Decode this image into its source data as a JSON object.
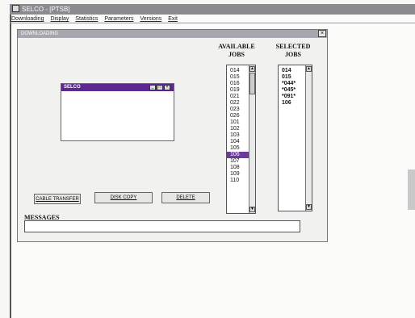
{
  "app": {
    "title": "SELCO - [PTSB]",
    "menu": [
      "Downloading",
      "Display",
      "Statistics",
      "Parameters",
      "Versions",
      "Exit"
    ]
  },
  "dialog": {
    "title": "DOWNLOADING",
    "close_glyph": "×"
  },
  "available_jobs": {
    "header_line1": "AVAILABLE",
    "header_line2": "JOBS",
    "items": [
      "014",
      "015",
      "016",
      "019",
      "021",
      "022",
      "023",
      "026",
      "101",
      "102",
      "103",
      "104",
      "105",
      "106",
      "107",
      "108",
      "109",
      "110"
    ],
    "selected_item": "106"
  },
  "selected_jobs": {
    "header_line1": "SELECTED",
    "header_line2": "JOBS",
    "items": [
      "014",
      "015",
      "*044*",
      "*045*",
      "*091*",
      "106"
    ]
  },
  "selco_window": {
    "title": "SELCO"
  },
  "buttons": {
    "cable_transfer": "CABLE TRANSFER",
    "disk_copy": "DISK COPY",
    "delete": "DELETE"
  },
  "messages": {
    "label": "MESSAGES",
    "text": ""
  },
  "icons": {
    "scroll_up": "scroll-up-arrow-icon",
    "scroll_down": "scroll-down-arrow-icon",
    "minimize": "minimize-icon",
    "maximize": "maximize-icon",
    "close": "close-icon"
  },
  "colors": {
    "selection": "#6b3a9c",
    "selco_titlebar": "#5c2a8f"
  }
}
